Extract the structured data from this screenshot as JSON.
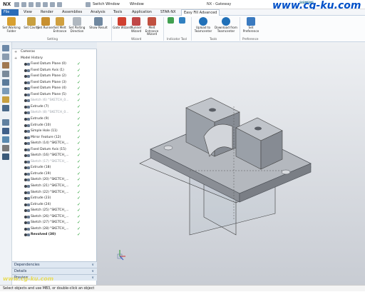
{
  "titlebar": {
    "app": "NX",
    "switch_window": "Switch Window",
    "window_menu": "Window",
    "title": "NX - Gateway",
    "brand": "SIEMENS",
    "watermark": "www.cg-ku.com"
  },
  "tabs": [
    "File",
    "View",
    "Render",
    "Assemblies",
    "Analysis",
    "Tools",
    "Application",
    "STAR-NX",
    "Easy Fill Advanced"
  ],
  "ribbon": {
    "buttons": [
      {
        "label": "Set Working Folder",
        "color": "#d8a030"
      },
      {
        "label": "Set Cavity",
        "color": "#c8a040"
      },
      {
        "label": "Set Runner",
        "color": "#c89030"
      },
      {
        "label": "Set Melt Entrance",
        "color": "#d0a040"
      },
      {
        "label": "Set Parting Direction",
        "color": "#b0b8c0"
      },
      {
        "label": "Show Result",
        "color": "#7088a0"
      },
      {
        "label": "Gate Wizard",
        "color": "#d04030"
      },
      {
        "label": "Runner Wizard",
        "color": "#c04848"
      },
      {
        "label": "Melt Entrance Wizard",
        "color": "#c05040"
      },
      {
        "label": "",
        "color": "#40a050"
      },
      {
        "label": "",
        "color": "#3080c0"
      },
      {
        "label": "Upload to Teamcenter",
        "color": "#2070b8"
      },
      {
        "label": "Download from Teamcenter",
        "color": "#2070b8"
      },
      {
        "label": "Set Preference",
        "color": "#3a7ac0"
      }
    ],
    "groups": [
      "Setting",
      "Wizard",
      "Indicator Tool",
      "Tools",
      "Preference"
    ]
  },
  "navigator": {
    "items": [
      {
        "label": "Cameras",
        "state": "top"
      },
      {
        "label": "Model History",
        "state": "top"
      },
      {
        "label": "Fixed Datum Plane (0)",
        "state": "normal"
      },
      {
        "label": "Fixed Datum Axis (1)",
        "state": "normal"
      },
      {
        "label": "Fixed Datum Plane (2)",
        "state": "normal"
      },
      {
        "label": "Fixed Datum Plane (3)",
        "state": "normal"
      },
      {
        "label": "Fixed Datum Plane (4)",
        "state": "normal"
      },
      {
        "label": "Fixed Datum Plane (5)",
        "state": "normal"
      },
      {
        "label": "Sketch (6) \"SKETCH_0...",
        "state": "sup"
      },
      {
        "label": "Extrude (7)",
        "state": "normal"
      },
      {
        "label": "Sketch (8) \"SKETCH_0...",
        "state": "sup"
      },
      {
        "label": "Extrude (9)",
        "state": "normal"
      },
      {
        "label": "Extrude (10)",
        "state": "normal"
      },
      {
        "label": "Simple Hole (11)",
        "state": "normal"
      },
      {
        "label": "Mirror Feature (12)",
        "state": "normal"
      },
      {
        "label": "Sketch (14) \"SKETCH_...",
        "state": "normal"
      },
      {
        "label": "Fixed Datum Axis (15)",
        "state": "normal"
      },
      {
        "label": "Sketch (16) \"SKETCH_...",
        "state": "normal"
      },
      {
        "label": "Sketch (17) \"SKETCH_...",
        "state": "sup"
      },
      {
        "label": "Extrude (18)",
        "state": "normal"
      },
      {
        "label": "Extrude (19)",
        "state": "normal"
      },
      {
        "label": "Sketch (20) \"SKETCH_...",
        "state": "normal"
      },
      {
        "label": "Sketch (21) \"SKETCH_...",
        "state": "normal"
      },
      {
        "label": "Sketch (22) \"SKETCH_...",
        "state": "normal"
      },
      {
        "label": "Extrude (23)",
        "state": "normal"
      },
      {
        "label": "Extrude (24)",
        "state": "normal"
      },
      {
        "label": "Sketch (25) \"SKETCH_...",
        "state": "normal"
      },
      {
        "label": "Sketch (26) \"SKETCH_...",
        "state": "normal"
      },
      {
        "label": "Sketch (27) \"SKETCH_...",
        "state": "normal"
      },
      {
        "label": "Sketch (28) \"SKETCH_...",
        "state": "normal"
      },
      {
        "label": "Revolved (30)",
        "state": "bold"
      }
    ],
    "panels": [
      "Dependencies",
      "Details",
      "Preview"
    ]
  },
  "status": "Select objects and use MB3, or double-click an object",
  "bottom_watermark": "www.cg-ku.com"
}
